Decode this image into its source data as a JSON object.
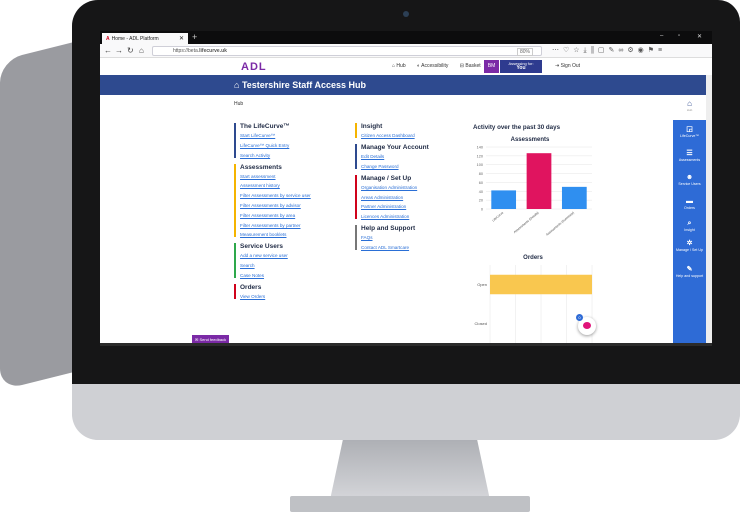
{
  "browser": {
    "tab_title": "Home - ADL Platform",
    "new_tab": "+",
    "url_prefix": "https://beta.",
    "url_domain": "lifecurve.uk",
    "zoom": "80%",
    "window_controls": [
      "–",
      "▫",
      "✕"
    ]
  },
  "header": {
    "logo": "ADL",
    "links": [
      "Hub",
      "Accessibility",
      "Basket"
    ],
    "avatar_initials": "BM",
    "assessing_label": "Assessing for:",
    "assessing_value": "You",
    "signout": "Sign Out"
  },
  "banner": {
    "title": "Testershire Staff Access Hub"
  },
  "breadcrumb": "Hub",
  "columns": {
    "left": [
      {
        "title": "The LifeCurve™",
        "color": "#2e4a8f",
        "links": [
          "Start LifeCurve™",
          "LifeCurve™ Quick Entry",
          "Search Activity"
        ]
      },
      {
        "title": "Assessments",
        "color": "#f5b400",
        "links": [
          "Start assessment",
          "Assessment history",
          "Filter Assessments by service user",
          "Filter Assessments by advisor",
          "Filter Assessments by area",
          "Filter Assessments by partner",
          "Measurement booklets"
        ]
      },
      {
        "title": "Service Users",
        "color": "#2ea84b",
        "links": [
          "Add a new service user",
          "Search",
          "Case Notes"
        ]
      },
      {
        "title": "Orders",
        "color": "#d0021b",
        "links": [
          "View Orders"
        ]
      }
    ],
    "middle": [
      {
        "title": "Insight",
        "color": "#f5b400",
        "links": [
          "Citizen Access Dashboard"
        ]
      },
      {
        "title": "Manage Your Account",
        "color": "#2e4a8f",
        "links": [
          "Edit Details",
          "Change Password"
        ]
      },
      {
        "title": "Manage / Set Up",
        "color": "#d0021b",
        "links": [
          "Organisation Administration",
          "Areas Administration",
          "Partner Administration",
          "Licences Administration"
        ]
      },
      {
        "title": "Help and Support",
        "color": "#777777",
        "links": [
          "FAQs",
          "Contact ADL Smartcare"
        ]
      }
    ]
  },
  "activity_title": "Activity over the past 30 days",
  "chart_data": [
    {
      "type": "bar",
      "title": "Assessments",
      "categories": [
        "LifeCurve",
        "Assessments (Details)",
        "Assessments (Summary)"
      ],
      "values": [
        42,
        126,
        50
      ],
      "colors": [
        "#2f8ff0",
        "#e0145f",
        "#2f8ff0"
      ],
      "ylim": [
        0,
        140
      ],
      "yticks": [
        0,
        20,
        40,
        60,
        80,
        100,
        120,
        140
      ],
      "grid": true
    },
    {
      "type": "bar",
      "orientation": "horizontal",
      "title": "Orders",
      "categories": [
        "Open",
        "Closed"
      ],
      "values": [
        1,
        0
      ],
      "colors": [
        "#f9c74f",
        "#f9c74f"
      ],
      "grid": true
    }
  ],
  "rail": {
    "top": {
      "label": "Hub",
      "icon": "home-icon"
    },
    "items": [
      {
        "label": "LifeCurve™",
        "glyph": "◲"
      },
      {
        "label": "Assessments",
        "glyph": "☰"
      },
      {
        "label": "Service Users",
        "glyph": "☻"
      },
      {
        "label": "Orders",
        "glyph": "▬"
      },
      {
        "label": "Insight",
        "glyph": "⌕"
      },
      {
        "label": "Manage / Set Up",
        "glyph": "✲"
      },
      {
        "label": "Help and support",
        "glyph": "✎"
      }
    ]
  },
  "feedback_label": "Send feedback",
  "chat_badge": "0"
}
